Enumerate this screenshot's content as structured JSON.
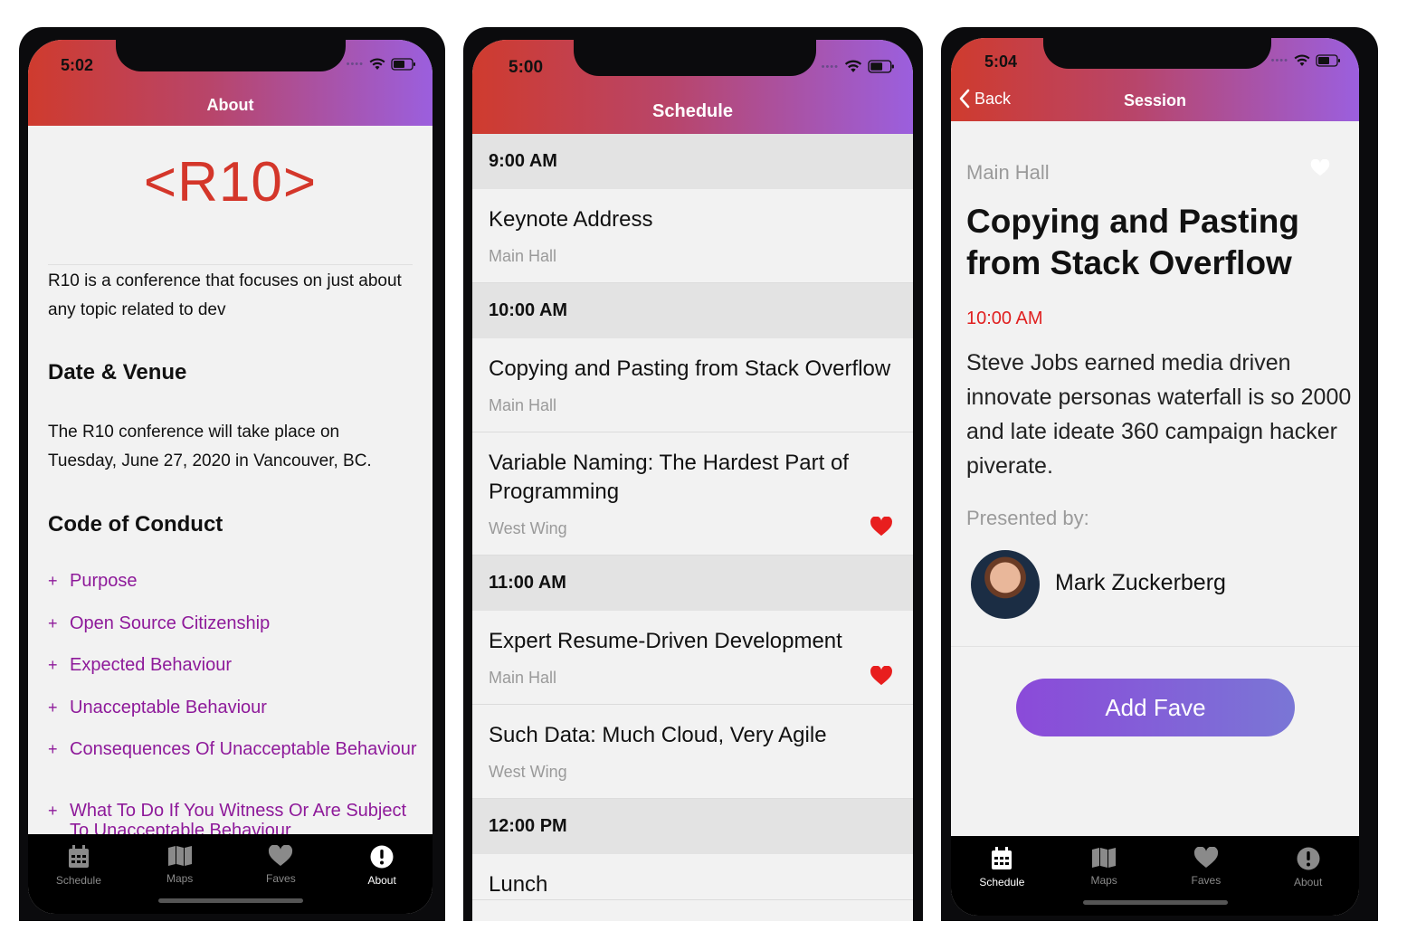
{
  "about_screen": {
    "time": "5:02",
    "header_title": "About",
    "logo": "<R10>",
    "intro": "R10 is a conference that focuses on just about any topic related to dev",
    "date_heading": "Date & Venue",
    "date_text": "The R10 conference will take place on Tuesday, June 27, 2020 in Vancouver, BC.",
    "coc_heading": "Code of Conduct",
    "coc_items": [
      "Purpose",
      "Open Source Citizenship",
      "Expected Behaviour",
      "Unacceptable Behaviour",
      "Consequences Of Unacceptable Behaviour",
      "What To Do If You Witness Or Are Subject To Unacceptable Behaviour"
    ],
    "plus": "+"
  },
  "schedule_screen": {
    "time": "5:00",
    "header_title": "Schedule",
    "slots": [
      {
        "time": "9:00 AM",
        "sessions": [
          {
            "title": "Keynote Address",
            "location": "Main Hall",
            "fave": false
          }
        ]
      },
      {
        "time": "10:00 AM",
        "sessions": [
          {
            "title": "Copying and Pasting from Stack Overflow",
            "location": "Main Hall",
            "fave": false
          },
          {
            "title": "Variable Naming: The Hardest Part of Programming",
            "location": "West Wing",
            "fave": true
          }
        ]
      },
      {
        "time": "11:00 AM",
        "sessions": [
          {
            "title": "Expert Resume-Driven Development",
            "location": "Main Hall",
            "fave": true
          },
          {
            "title": "Such Data: Much Cloud, Very Agile",
            "location": "West Wing",
            "fave": false
          }
        ]
      },
      {
        "time": "12:00 PM",
        "sessions": [
          {
            "title": "Lunch",
            "location": "",
            "fave": false
          }
        ]
      }
    ]
  },
  "session_screen": {
    "time": "5:04",
    "header_title": "Session",
    "back_label": "Back",
    "location": "Main Hall",
    "title": "Copying and Pasting from Stack Overflow",
    "start_time": "10:00 AM",
    "description": "Steve Jobs earned media driven innovate personas waterfall is so 2000 and late ideate 360 campaign hacker piverate.",
    "presented_by": "Presented by:",
    "speaker": "Mark Zuckerberg",
    "button_label": "Add Fave"
  },
  "tabs": {
    "schedule": "Schedule",
    "maps": "Maps",
    "faves": "Faves",
    "about": "About"
  },
  "colors": {
    "header_start": "#cf3b2e",
    "header_end": "#9b5fde",
    "accent_red": "#d4362a",
    "link_purple": "#8e1a9a",
    "fave_red": "#e81e1e"
  },
  "icons": {
    "signal": "signal-dots-icon",
    "wifi": "wifi-icon",
    "battery": "battery-icon",
    "calendar": "calendar-icon",
    "map": "map-icon",
    "heart": "heart-icon",
    "info": "info-icon",
    "back": "chevron-left-icon"
  }
}
